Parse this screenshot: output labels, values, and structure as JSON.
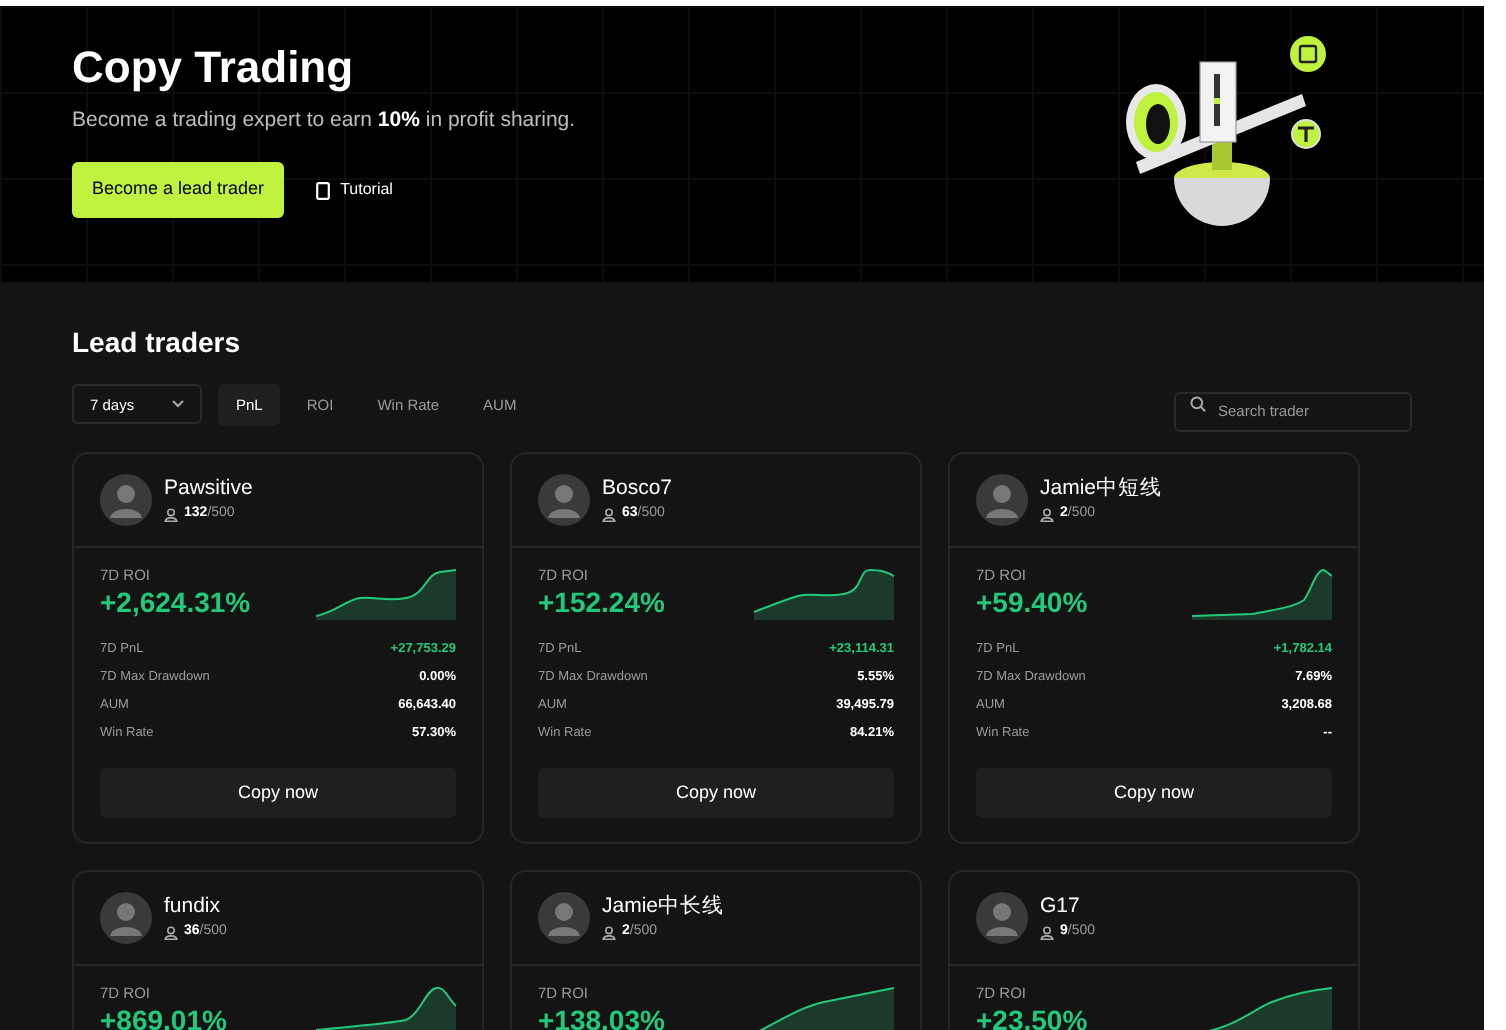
{
  "hero": {
    "title": "Copy Trading",
    "subtitle": "Become a trading expert to earn **10%** in profit sharing.",
    "primary_button": "Become a lead trader",
    "tutorial_link": "Tutorial"
  },
  "lead_traders": {
    "heading": "Lead traders",
    "period_select": "7 days",
    "sort_tabs": [
      {
        "label": "PnL",
        "selected": true
      },
      {
        "label": "ROI",
        "selected": false
      },
      {
        "label": "Win Rate",
        "selected": false
      },
      {
        "label": "AUM",
        "selected": false
      }
    ],
    "search": {
      "placeholder": "Search trader"
    },
    "traders": [
      {
        "name": "Pawsitive",
        "followers": "**132**/500",
        "roi_label": "7D ROI",
        "roi": "+2,624.31%",
        "stats": [
          {
            "label": "7D PnL",
            "value": "+27,753.29",
            "kind": "gain"
          },
          {
            "label": "7D Max Drawdown",
            "value": "0.00%",
            "kind": "plain"
          },
          {
            "label": "AUM",
            "value": "66,643.40",
            "kind": "plain"
          },
          {
            "label": "Win Rate",
            "value": "57.30%",
            "kind": "plain"
          }
        ],
        "button": "Copy now"
      },
      {
        "name": "Bosco7",
        "followers": "**63**/500",
        "roi_label": "7D ROI",
        "roi": "+152.24%",
        "stats": [
          {
            "label": "7D PnL",
            "value": "+23,114.31",
            "kind": "gain"
          },
          {
            "label": "7D Max Drawdown",
            "value": "5.55%",
            "kind": "plain"
          },
          {
            "label": "AUM",
            "value": "39,495.79",
            "kind": "plain"
          },
          {
            "label": "Win Rate",
            "value": "84.21%",
            "kind": "plain"
          }
        ],
        "button": "Copy now"
      },
      {
        "name": "Jamie中短线",
        "followers": "**2**/500",
        "roi_label": "7D ROI",
        "roi": "+59.40%",
        "stats": [
          {
            "label": "7D PnL",
            "value": "+1,782.14",
            "kind": "gain"
          },
          {
            "label": "7D Max Drawdown",
            "value": "7.69%",
            "kind": "plain"
          },
          {
            "label": "AUM",
            "value": "3,208.68",
            "kind": "plain"
          },
          {
            "label": "Win Rate",
            "value": "--",
            "kind": "plain"
          }
        ],
        "button": "Copy now"
      },
      {
        "name": "fundix",
        "followers": "**36**/500",
        "roi_label": "7D ROI",
        "roi": "+869.01%"
      },
      {
        "name": "Jamie中长线",
        "followers": "**2**/500",
        "roi_label": "7D ROI",
        "roi": "+138.03%"
      },
      {
        "name": "G17",
        "followers": "**9**/500",
        "roi_label": "7D ROI",
        "roi": "+23.50%"
      }
    ]
  }
}
